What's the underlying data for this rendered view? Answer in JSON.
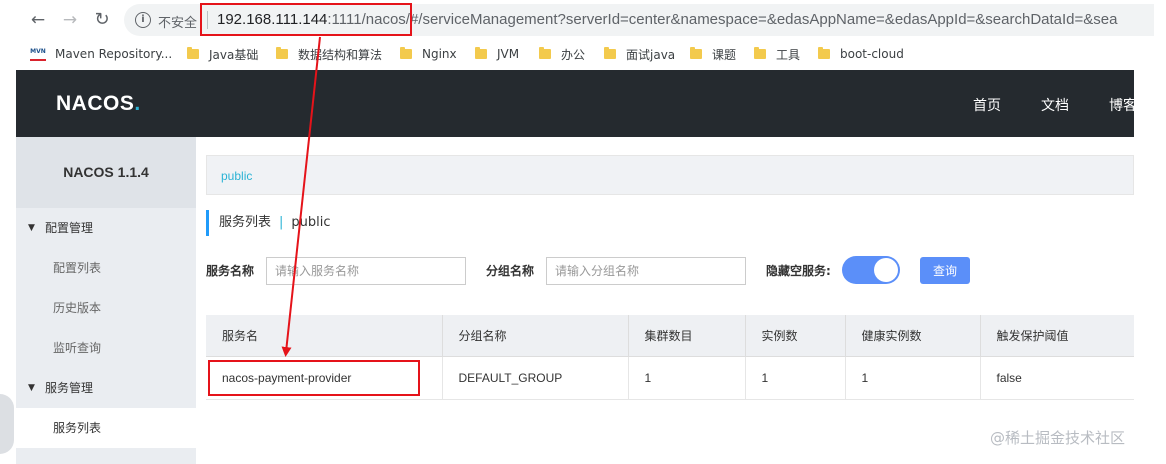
{
  "browser": {
    "insecure_label": "不安全",
    "url_host": "192.168.111.144",
    "url_rest": ":1111/nacos/#/serviceManagement?serverId=center&namespace=&edasAppName=&edasAppId=&searchDataId=&sea"
  },
  "bookmarks": [
    {
      "label": "Maven Repository...",
      "icon": "maven-icon"
    },
    {
      "label": "Java基础",
      "icon": "folder-icon"
    },
    {
      "label": "数据结构和算法",
      "icon": "folder-icon"
    },
    {
      "label": "Nginx",
      "icon": "folder-icon"
    },
    {
      "label": "JVM",
      "icon": "folder-icon"
    },
    {
      "label": "办公",
      "icon": "folder-icon"
    },
    {
      "label": "面试java",
      "icon": "folder-icon"
    },
    {
      "label": "课题",
      "icon": "folder-icon"
    },
    {
      "label": "工具",
      "icon": "folder-icon"
    },
    {
      "label": "boot-cloud",
      "icon": "folder-icon"
    }
  ],
  "header": {
    "logo_text": "NACOS",
    "logo_dot": ".",
    "nav": [
      "首页",
      "文档",
      "博客"
    ]
  },
  "sidebar": {
    "version": "NACOS 1.1.4",
    "groups": [
      {
        "label": "配置管理",
        "items": [
          "配置列表",
          "历史版本",
          "监听查询"
        ]
      },
      {
        "label": "服务管理",
        "items": [
          "服务列表"
        ]
      }
    ]
  },
  "main": {
    "namespace_crumb": "public",
    "title": "服务列表",
    "title_sep": "|",
    "title_ns": "public",
    "filters": {
      "service_name_label": "服务名称",
      "service_name_placeholder": "请输入服务名称",
      "group_name_label": "分组名称",
      "group_name_placeholder": "请输入分组名称",
      "hide_empty_label": "隐藏空服务:",
      "hide_empty_on": true,
      "query_button": "查询"
    },
    "table": {
      "headers": [
        "服务名",
        "分组名称",
        "集群数目",
        "实例数",
        "健康实例数",
        "触发保护阈值"
      ],
      "rows": [
        [
          "nacos-payment-provider",
          "DEFAULT_GROUP",
          "1",
          "1",
          "1",
          "false"
        ]
      ]
    }
  },
  "watermark": "@稀土掘金技术社区",
  "colors": {
    "header_bg": "#252a2f",
    "accent_cyan": "#2bb3d5",
    "primary_blue": "#5b8ff9",
    "annotation_red": "#e5131a"
  }
}
